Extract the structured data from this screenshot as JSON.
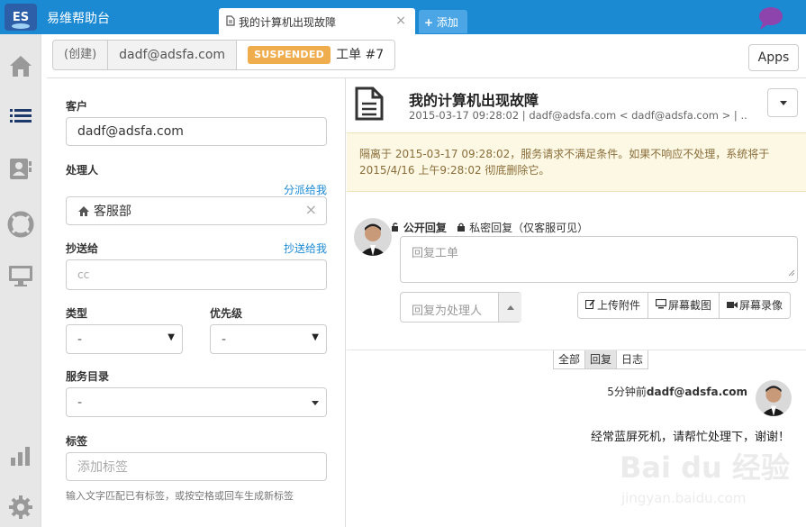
{
  "app": {
    "title": "易维帮助台"
  },
  "tabs": {
    "active_label": "我的计算机出现故障",
    "add_label": "添加"
  },
  "header": {
    "created": "(创建)",
    "email": "dadf@adsfa.com",
    "status_badge": "SUSPENDED",
    "ticket_no": "工单 #7",
    "apps_label": "Apps"
  },
  "form": {
    "customer_label": "客户",
    "customer_value": "dadf@adsfa.com",
    "handler_label": "处理人",
    "assign_link": "分派给我",
    "handler_value": "客服部",
    "cc_label": "抄送给",
    "cc_link": "抄送给我",
    "cc_placeholder": "cc",
    "type_label": "类型",
    "type_value": "-",
    "priority_label": "优先级",
    "priority_value": "-",
    "catalog_label": "服务目录",
    "catalog_value": "-",
    "tags_label": "标签",
    "tags_placeholder": "添加标签",
    "tags_hint": "输入文字匹配已有标签，或按空格或回车生成新标签"
  },
  "ticket": {
    "title": "我的计算机出现故障",
    "meta": "2015-03-17 09:28:02 | dadf@adsfa.com < dadf@adsfa.com > | ...",
    "warning": "隔离于 2015-03-17 09:28:02，服务请求不满足条件。如果不响应不处理，系统将于 2015/4/16 上午9:28:02 彻底删除它。"
  },
  "reply": {
    "public_label": "公开回复",
    "private_label": "私密回复（仅客服可见）",
    "placeholder": "回复工单",
    "reply_to": "回复为处理人",
    "buttons": [
      "上传附件",
      "屏幕截图",
      "屏幕录像"
    ]
  },
  "filters": [
    "全部",
    "回复",
    "日志"
  ],
  "message": {
    "time": "5分钟前",
    "author": "dadf@adsfa.com",
    "body": "经常蓝屏死机，请帮忙处理下，谢谢！"
  },
  "watermark": {
    "text": "Bai du 经验",
    "sub": "jingyan.baidu.com"
  },
  "colors": {
    "accent": "#1b8ad3",
    "badge": "#f0ad4e",
    "warning_bg": "#fcf8e3",
    "warning_text": "#8a6d3b"
  }
}
